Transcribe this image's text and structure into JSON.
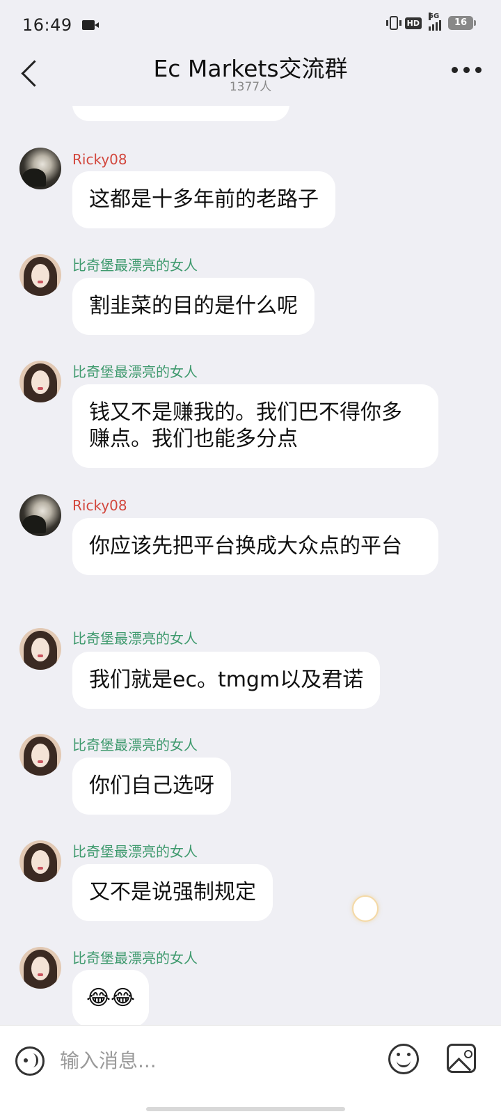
{
  "status_bar": {
    "time": "16:49",
    "network": "5G",
    "hd": "HD",
    "battery": "16"
  },
  "header": {
    "title": "Ec Markets交流群",
    "member_count": "1377人"
  },
  "messages": [
    {
      "sender": "Ricky08",
      "text": "这都是十多年前的老路子"
    },
    {
      "sender": "比奇堡最漂亮的女人",
      "text": "割韭菜的目的是什么呢"
    },
    {
      "sender": "比奇堡最漂亮的女人",
      "text": "钱又不是赚我的。我们巴不得你多赚点。我们也能多分点"
    },
    {
      "sender": "Ricky08",
      "text": "你应该先把平台换成大众点的平台"
    },
    {
      "sender": "比奇堡最漂亮的女人",
      "text": "我们就是ec。tmgm以及君诺"
    },
    {
      "sender": "比奇堡最漂亮的女人",
      "text": "你们自己选呀"
    },
    {
      "sender": "比奇堡最漂亮的女人",
      "text": "又不是说强制规定"
    },
    {
      "sender": "比奇堡最漂亮的女人",
      "text": "😂😂"
    }
  ],
  "input": {
    "placeholder": "输入消息..."
  },
  "icons": {
    "back": "back-arrow-icon",
    "more": "more-dots-icon",
    "voice": "voice-icon",
    "emoji": "emoji-icon",
    "image": "image-icon"
  },
  "colors": {
    "name_ricky": "#d2463c",
    "name_girl": "#3f9a6e",
    "background": "#efeff4"
  }
}
